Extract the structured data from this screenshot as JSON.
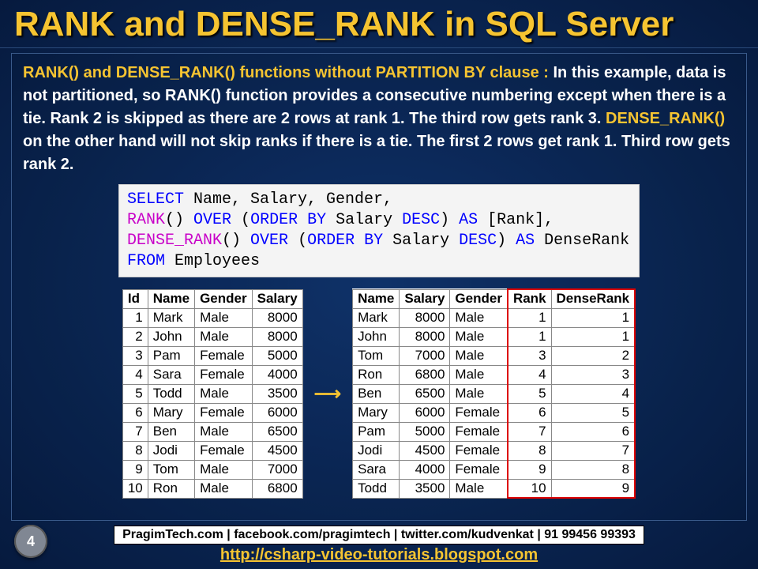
{
  "title": "RANK and DENSE_RANK in SQL Server",
  "explanation": {
    "lead": "RANK() and DENSE_RANK() functions without PARTITION BY clause : ",
    "body1": "In this example, data is not partitioned, so RANK() function provides a consecutive numbering except when there is a tie. Rank 2 is skipped as there are 2 rows at rank 1. The third row gets rank 3. ",
    "mid": "DENSE_RANK()",
    "body2": " on the other hand will not skip ranks if there is a tie. The first 2 rows get rank 1. Third row gets rank 2."
  },
  "sql": {
    "line1a": "SELECT",
    "line1b": " Name, Salary, Gender,",
    "line2a": "RANK",
    "line2b": "()",
    "line2c": " OVER ",
    "line2d": "(",
    "line2e": "ORDER BY",
    "line2f": " Salary ",
    "line2g": "DESC",
    "line2h": ")",
    "line2i": " AS",
    "line2j": " [Rank],",
    "line3a": "DENSE_RANK",
    "line3b": "()",
    "line3c": " OVER ",
    "line3d": "(",
    "line3e": "ORDER BY",
    "line3f": " Salary ",
    "line3g": "DESC",
    "line3h": ")",
    "line3i": " AS",
    "line3j": " DenseRank",
    "line4a": "FROM",
    "line4b": " Employees"
  },
  "chart_data": [
    {
      "type": "table",
      "title": "Employees",
      "columns": [
        "Id",
        "Name",
        "Gender",
        "Salary"
      ],
      "rows": [
        [
          1,
          "Mark",
          "Male",
          8000
        ],
        [
          2,
          "John",
          "Male",
          8000
        ],
        [
          3,
          "Pam",
          "Female",
          5000
        ],
        [
          4,
          "Sara",
          "Female",
          4000
        ],
        [
          5,
          "Todd",
          "Male",
          3500
        ],
        [
          6,
          "Mary",
          "Female",
          6000
        ],
        [
          7,
          "Ben",
          "Male",
          6500
        ],
        [
          8,
          "Jodi",
          "Female",
          4500
        ],
        [
          9,
          "Tom",
          "Male",
          7000
        ],
        [
          10,
          "Ron",
          "Male",
          6800
        ]
      ]
    },
    {
      "type": "table",
      "title": "Result",
      "columns": [
        "Name",
        "Salary",
        "Gender",
        "Rank",
        "DenseRank"
      ],
      "rows": [
        [
          "Mark",
          8000,
          "Male",
          1,
          1
        ],
        [
          "John",
          8000,
          "Male",
          1,
          1
        ],
        [
          "Tom",
          7000,
          "Male",
          3,
          2
        ],
        [
          "Ron",
          6800,
          "Male",
          4,
          3
        ],
        [
          "Ben",
          6500,
          "Male",
          5,
          4
        ],
        [
          "Mary",
          6000,
          "Female",
          6,
          5
        ],
        [
          "Pam",
          5000,
          "Female",
          7,
          6
        ],
        [
          "Jodi",
          4500,
          "Female",
          8,
          7
        ],
        [
          "Sara",
          4000,
          "Female",
          9,
          8
        ],
        [
          "Todd",
          3500,
          "Male",
          10,
          9
        ]
      ]
    }
  ],
  "arrow": "⟶",
  "footer": {
    "box": "PragimTech.com | facebook.com/pragimtech | twitter.com/kudvenkat | 91 99456 99393",
    "link": "http://csharp-video-tutorials.blogspot.com"
  },
  "slide_number": "4"
}
